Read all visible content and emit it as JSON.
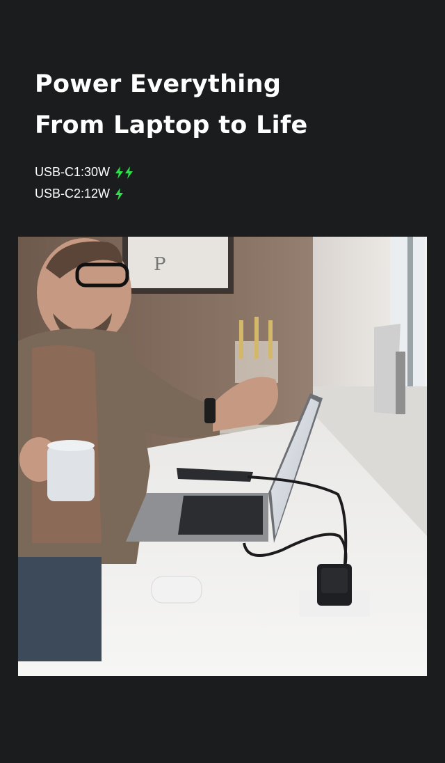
{
  "headline": {
    "line1": "Power Everything",
    "line2": "From Laptop to Life"
  },
  "specs": [
    {
      "label": "USB-C1:30W",
      "bolt_count": 2,
      "bolt_icon": "lightning-bolt-icon"
    },
    {
      "label": "USB-C2:12W",
      "bolt_count": 1,
      "bolt_icon": "lightning-bolt-icon"
    }
  ],
  "photo": {
    "frame_letter": "P"
  },
  "colors": {
    "background": "#1b1c1e",
    "text": "#ffffff",
    "bolt": "#2ee04c"
  }
}
